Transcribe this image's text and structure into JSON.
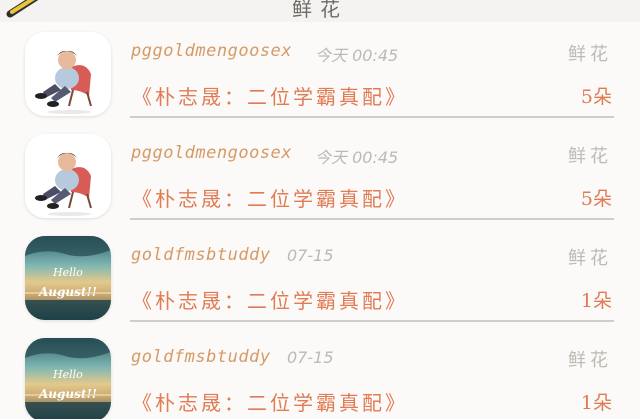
{
  "header": {
    "title": "鲜花",
    "edit_icon": "pencil-icon"
  },
  "colors": {
    "username": "#d69a66",
    "accent": "#e07b54",
    "muted": "#bdb9b3",
    "divider": "#cfcdca"
  },
  "gifts": [
    {
      "avatar": "person-in-chair-illustration",
      "username": "pggoldmengoosex",
      "time": "今天 00:45",
      "gift_label": "鲜花",
      "message": "《朴志晟：二位学霸真配》",
      "count": "5朵"
    },
    {
      "avatar": "person-in-chair-illustration",
      "username": "pggoldmengoosex",
      "time": "今天 00:45",
      "gift_label": "鲜花",
      "message": "《朴志晟：二位学霸真配》",
      "count": "5朵"
    },
    {
      "avatar": "hello-august-sunset-photo",
      "avatar_text": [
        "Hello",
        "August!!"
      ],
      "username": "goldfmsbtuddy",
      "time": "07-15",
      "gift_label": "鲜花",
      "message": "《朴志晟：二位学霸真配》",
      "count": "1朵"
    },
    {
      "avatar": "hello-august-sunset-photo",
      "avatar_text": [
        "Hello",
        "August!!"
      ],
      "username": "goldfmsbtuddy",
      "time": "07-15",
      "gift_label": "鲜花",
      "message": "《朴志晟：二位学霸真配》",
      "count": "1朵"
    }
  ]
}
